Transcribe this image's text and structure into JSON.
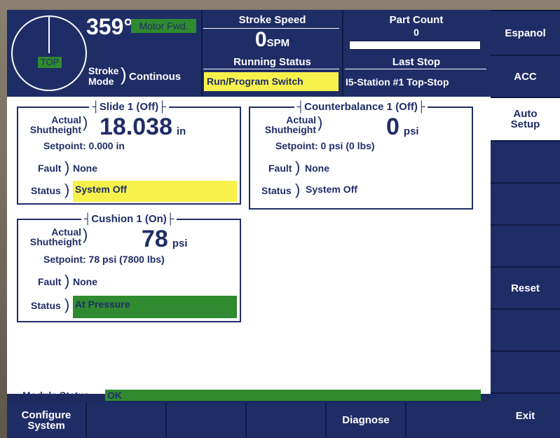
{
  "header": {
    "angle": "359°",
    "motor_label": "Motor Fwd.",
    "dial_label": "TOP",
    "stroke_mode_label_1": "Stroke",
    "stroke_mode_label_2": "Mode",
    "stroke_mode_value": "Continous",
    "stroke_speed_title": "Stroke Speed",
    "stroke_speed_value": "0",
    "stroke_speed_unit": "SPM",
    "running_status_title": "Running Status",
    "running_status_value": "Run/Program Switch",
    "part_count_title": "Part Count",
    "part_count_value": "0",
    "last_stop_title": "Last Stop",
    "last_stop_value": "I5-Station #1 Top-Stop"
  },
  "side_buttons": [
    "Espanol",
    "ACC",
    "Auto Setup",
    "",
    "",
    "",
    "Reset",
    "",
    "",
    "Exit"
  ],
  "bottom_buttons": [
    "Configure System",
    "",
    "",
    "",
    "Diagnose",
    ""
  ],
  "panels": {
    "slide": {
      "title": "Slide 1 (Off)",
      "actual_label_1": "Actual",
      "actual_label_2": "Shutheight",
      "value": "18.038",
      "unit": "in",
      "setpoint": "Setpoint: 0.000 in",
      "fault_label": "Fault",
      "fault_value": "None",
      "status_label": "Status",
      "status_value": "System Off",
      "status_color": "#f7f24b"
    },
    "counterbalance": {
      "title": "Counterbalance 1 (Off)",
      "actual_label_1": "Actual",
      "actual_label_2": "Shutheight",
      "value": "0",
      "unit": "psi",
      "setpoint": "Setpoint: 0 psi  (0 lbs)",
      "fault_label": "Fault",
      "fault_value": "None",
      "status_label": "Status",
      "status_value": "System Off"
    },
    "cushion": {
      "title": "Cushion 1 (On)",
      "actual_label_1": "Actual",
      "actual_label_2": "Shutheight",
      "value": "78",
      "unit": "psi",
      "setpoint": "Setpoint: 78 psi  (7800 lbs)",
      "fault_label": "Fault",
      "fault_value": "None",
      "status_label": "Status",
      "status_value": "At Pressure",
      "status_color": "#2f8a30"
    }
  },
  "module_status": {
    "label": "Module Status:",
    "value": "OK",
    "color": "#2f8a30"
  }
}
